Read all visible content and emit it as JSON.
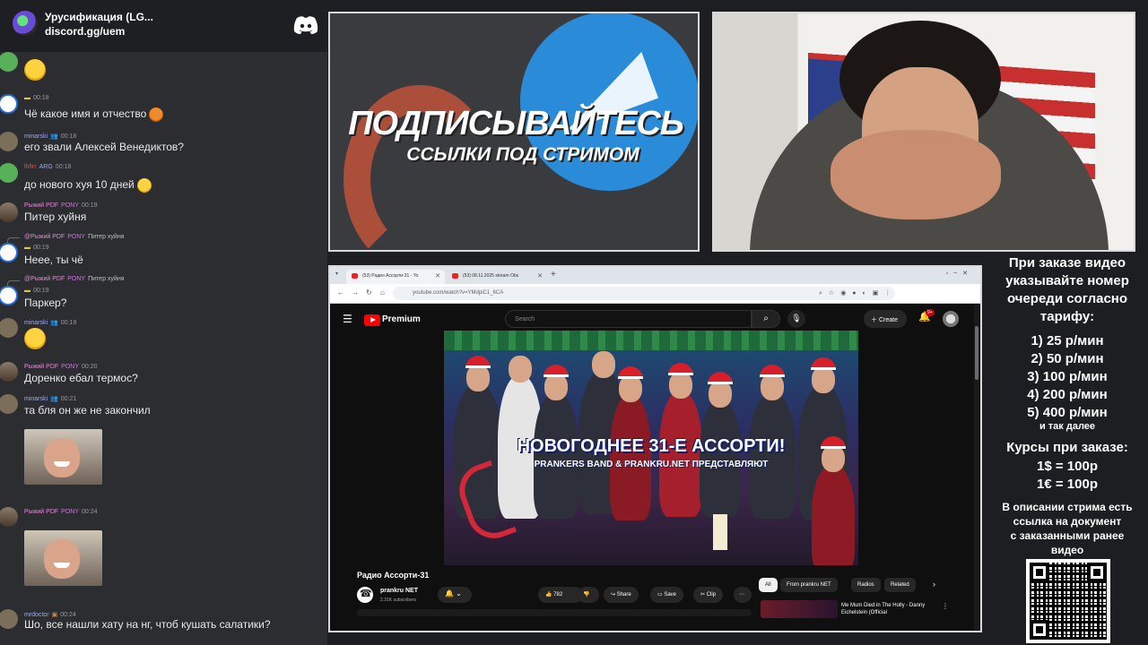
{
  "chat": {
    "server_name": "Урусификация (LG...",
    "server_link": "discord.gg/uem",
    "messages": [
      {
        "time": "00:18",
        "text": "Чё какое имя и отчество"
      },
      {
        "user": "minarski",
        "time": "00:18",
        "text": "его звали Алексей Венедиктов?"
      },
      {
        "user": "lhfirr",
        "tag": "ARG",
        "time": "00:18",
        "text": "до нового хуя 10 дней"
      },
      {
        "user": "Рыжий PDF",
        "tag": "PONY",
        "time": "00:19",
        "text": "Питер хуйня"
      },
      {
        "reply_user": "@Рыжий PDF",
        "reply_tag": "PONY",
        "reply_text": "Питер хуйня",
        "time": "00:19",
        "text": "Неее, ты чё"
      },
      {
        "reply_user": "@Рыжий PDF",
        "reply_tag": "PONY",
        "reply_text": "Питер хуйня",
        "time": "00:19",
        "text": "Паркер?"
      },
      {
        "user": "minarski",
        "time": "00:19"
      },
      {
        "user": "Рыжий PDF",
        "tag": "PONY",
        "time": "00:20",
        "text": "Доренко ебал термос?"
      },
      {
        "user": "minarski",
        "time": "00:21",
        "text": "та бля он же не закончил"
      },
      {
        "user": "Рыжий PDF",
        "tag": "PONY",
        "time": "00:24"
      },
      {
        "user": "mrdoctor",
        "time": "00:24",
        "text": "Шо, все нашли хату на нг, чтоб кушать салатики?"
      }
    ]
  },
  "promo": {
    "title": "ПОДПИСЫВАЙТЕСЬ",
    "subtitle": "ССЫЛКИ ПОД СТРИМОМ"
  },
  "browser": {
    "tabs": [
      {
        "label": "(53) Радио Ассорти-31 - Yo"
      },
      {
        "label": "(53) 08.11.2025 stream Obs"
      }
    ],
    "url": "youtube.com/watch?v=YMdpiC1_6CA"
  },
  "youtube": {
    "brand": "Premium",
    "search_placeholder": "Search",
    "create_label": "Create",
    "notif_count": "9+",
    "video_title": "Радио Ассорти-31",
    "channel_name": "prankru NET",
    "channel_subs": "2.31K subscribers",
    "likes": "782",
    "share_label": "Share",
    "save_label": "Save",
    "clip_label": "Clip",
    "chips": [
      "All",
      "From prankru NET",
      "Radios",
      "Related"
    ],
    "rec_title": "Me Mum Died in The Holly - Danny Eichelstein (Official",
    "thumb_title": "НОВОГОДНЕЕ 31-Е АССОРТИ!",
    "thumb_sub": "PRANKERS BAND & PRANKRU.NET ПРЕДСТАВЛЯЮТ"
  },
  "prices": {
    "heading_lines": [
      "При заказе видео",
      "указывайте номер",
      "очереди согласно",
      "тарифу:"
    ],
    "tiers": [
      "1) 25 р/мин",
      "2) 50 р/мин",
      "3) 100 р/мин",
      "4) 200 р/мин",
      "5) 400 р/мин"
    ],
    "etc": "и так далее",
    "rates_heading": "Курсы при заказе:",
    "rates": [
      "1$ = 100р",
      "1€ = 100р"
    ],
    "note_lines": [
      "В описании стрима есть",
      "ссылка на документ",
      "с заказанными ранее",
      "видео"
    ]
  }
}
